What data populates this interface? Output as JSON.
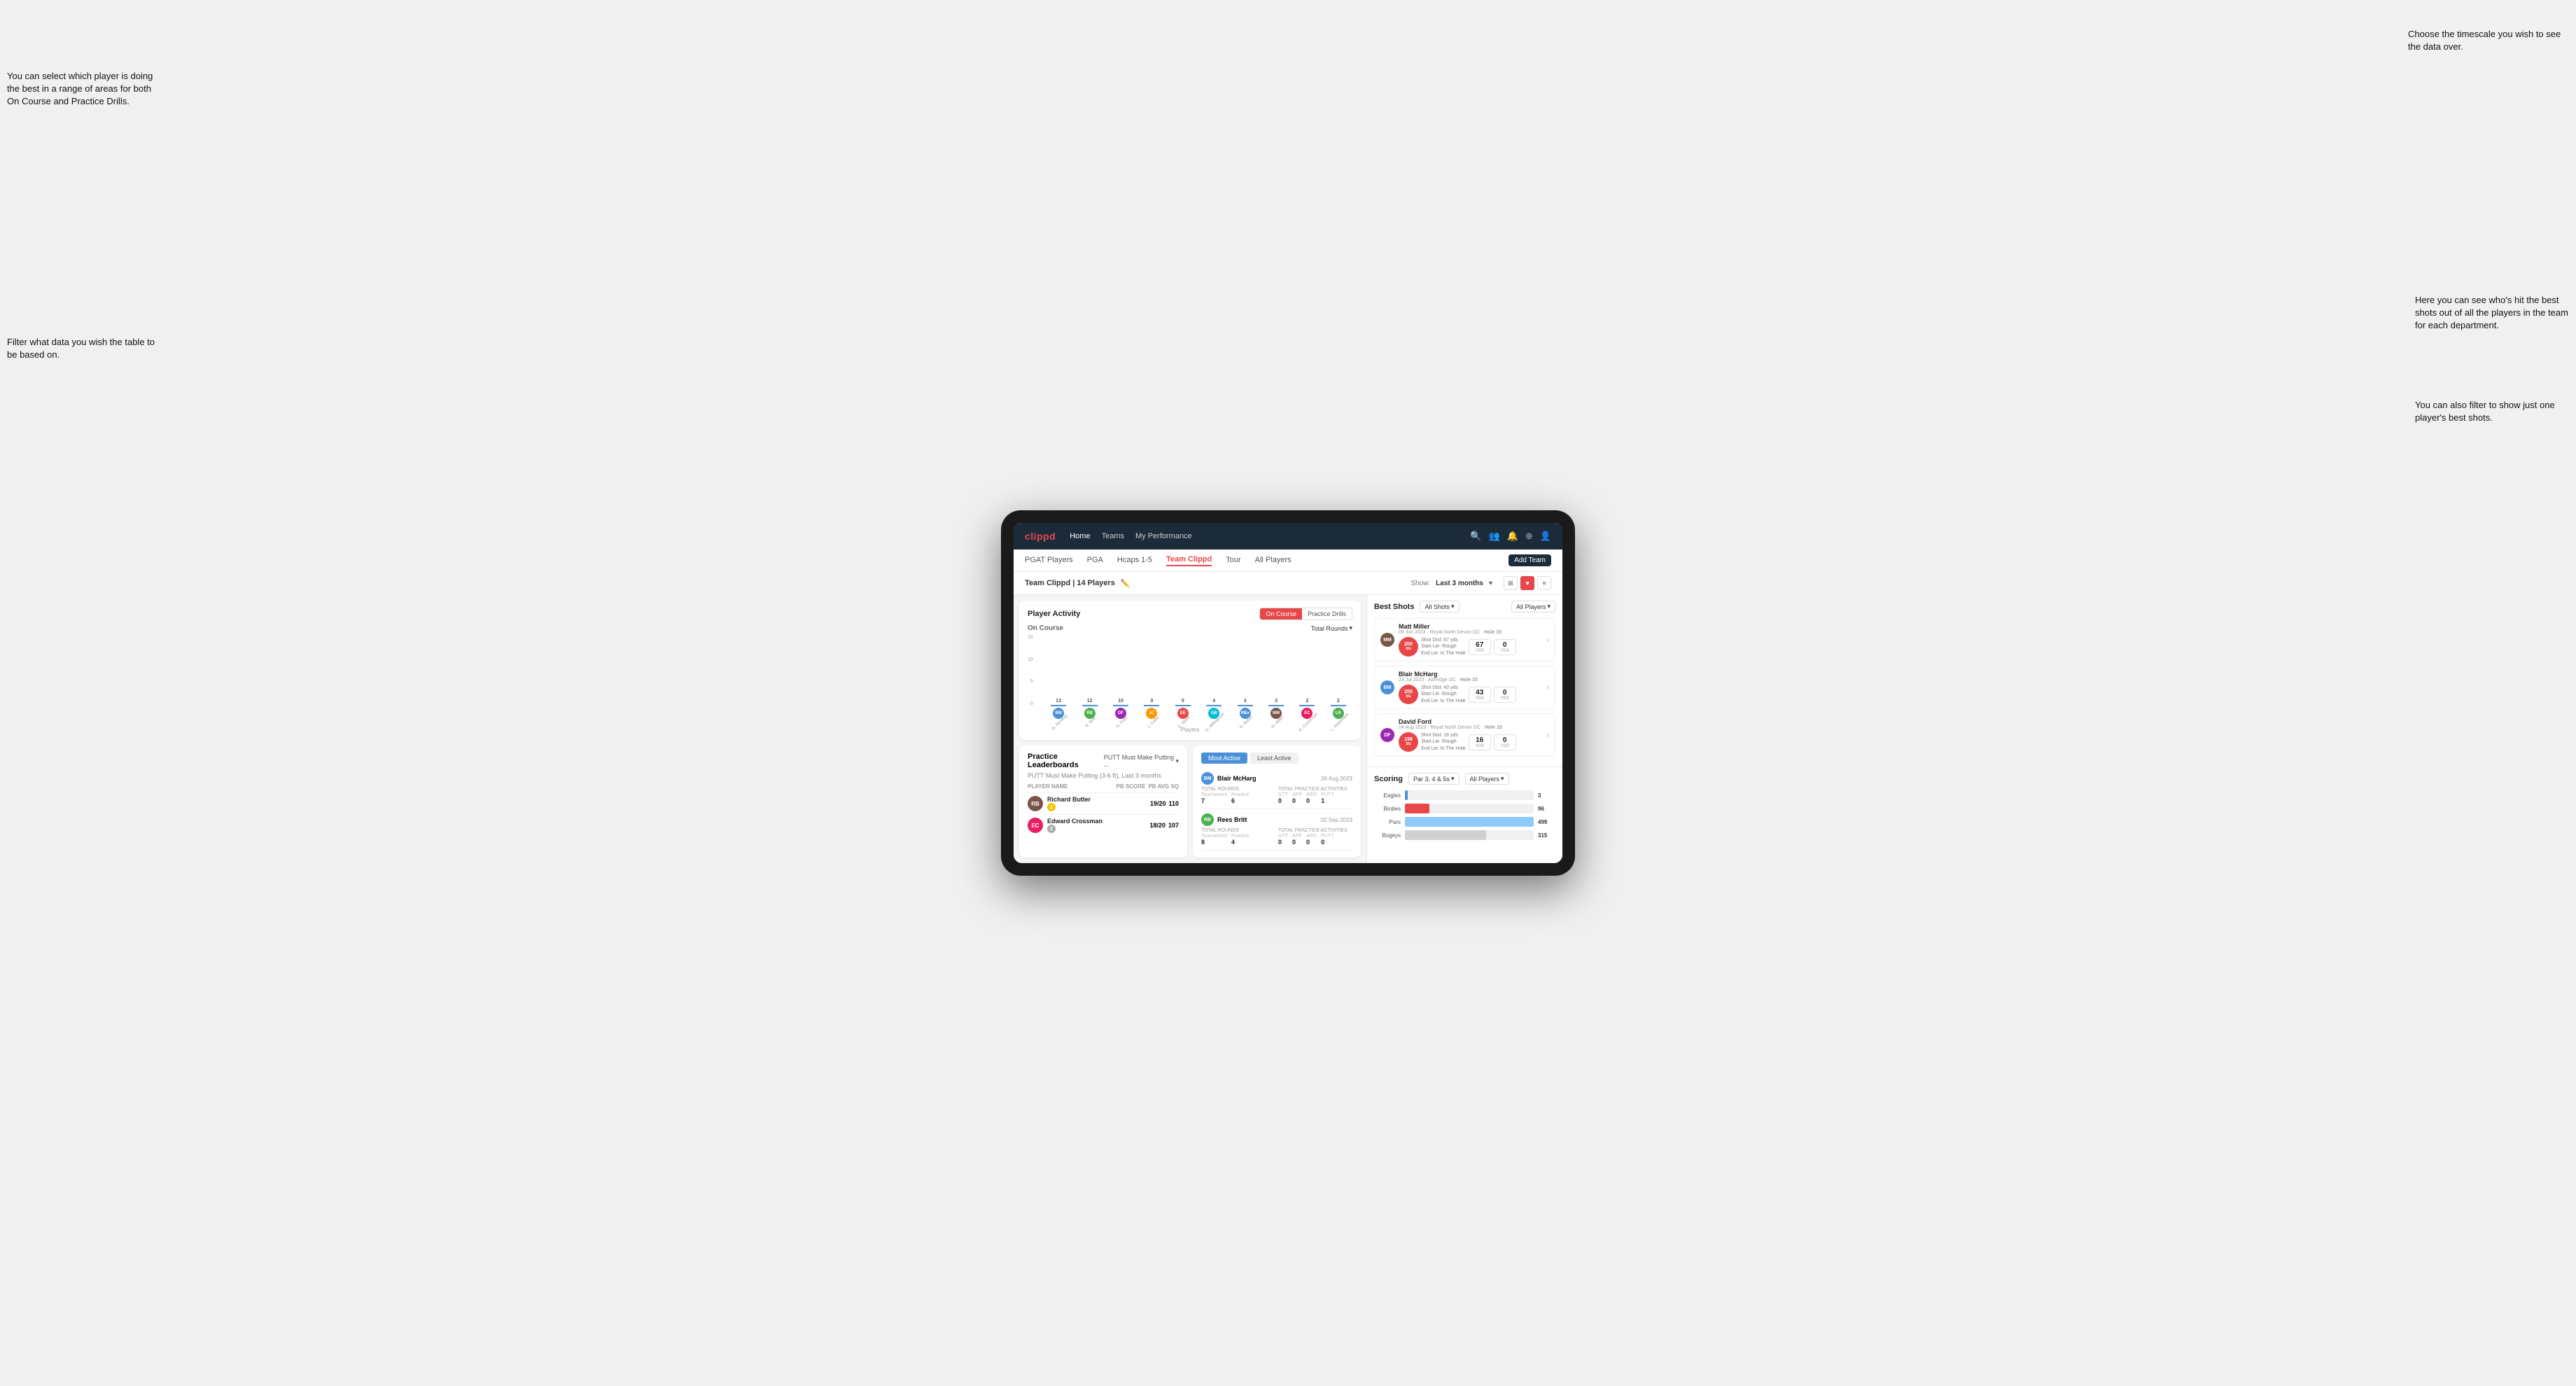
{
  "annotations": {
    "top_right": "Choose the timescale you wish to see the data over.",
    "left_top": "You can select which player is doing the best in a range of areas for both On Course and Practice Drills.",
    "left_bottom": "Filter what data you wish the table to be based on.",
    "right_mid": "Here you can see who's hit the best shots out of all the players in the team for each department.",
    "right_bottom": "You can also filter to show just one player's best shots."
  },
  "navbar": {
    "logo": "clippd",
    "links": [
      "Home",
      "Teams",
      "My Performance"
    ],
    "icons": [
      "search",
      "people",
      "bell",
      "plus-circle",
      "user-circle"
    ]
  },
  "sub_nav": {
    "tabs": [
      "PGAT Players",
      "PGA",
      "Hcaps 1-5",
      "Team Clippd",
      "Tour",
      "All Players"
    ],
    "active": "Team Clippd",
    "add_btn": "Add Team"
  },
  "team_header": {
    "team_name": "Team Clippd | 14 Players",
    "show_label": "Show:",
    "show_value": "Last 3 months",
    "view_icons": [
      "grid",
      "heart",
      "list"
    ]
  },
  "player_activity": {
    "title": "Player Activity",
    "toggle_options": [
      "On Course",
      "Practice Drills"
    ],
    "section_title": "On Course",
    "chart_dropdown": "Total Rounds",
    "y_labels": [
      "15",
      "10",
      "5",
      "0"
    ],
    "bars": [
      {
        "name": "B. McHarg",
        "value": 13,
        "height": 87,
        "initials": "BM",
        "color": "av-blue"
      },
      {
        "name": "R. Britt",
        "value": 12,
        "height": 80,
        "initials": "RB",
        "color": "av-green"
      },
      {
        "name": "D. Ford",
        "value": 10,
        "height": 67,
        "initials": "DF",
        "color": "av-purple"
      },
      {
        "name": "J. Coles",
        "value": 9,
        "height": 60,
        "initials": "JC",
        "color": "av-orange"
      },
      {
        "name": "E. Ebert",
        "value": 5,
        "height": 33,
        "initials": "EE",
        "color": "av-red"
      },
      {
        "name": "G. Billingham",
        "value": 4,
        "height": 27,
        "initials": "GB",
        "color": "av-teal"
      },
      {
        "name": "R. Butler",
        "value": 3,
        "height": 20,
        "initials": "RBu",
        "color": "av-blue"
      },
      {
        "name": "M. Miller",
        "value": 3,
        "height": 20,
        "initials": "MM",
        "color": "av-brown"
      },
      {
        "name": "E. Crossman",
        "value": 2,
        "height": 13,
        "initials": "EC",
        "color": "av-pink"
      },
      {
        "name": "L. Robertson",
        "value": 2,
        "height": 13,
        "initials": "LR",
        "color": "av-green"
      }
    ],
    "x_label": "Players",
    "y_axis_label": "Total Rounds"
  },
  "practice_leaderboards": {
    "title": "Practice Leaderboards",
    "dropdown": "PUTT Must Make Putting ...",
    "subtitle": "PUTT Must Make Putting (3-6 ft), Last 3 months",
    "columns": [
      "PLAYER NAME",
      "PB SCORE",
      "PB AVG SQ"
    ],
    "players": [
      {
        "name": "Richard Butler",
        "rank": 1,
        "rank_type": "gold",
        "pb_score": "19/20",
        "pb_avg": "110",
        "initials": "RB",
        "color": "av-brown"
      },
      {
        "name": "Edward Crossman",
        "rank": 2,
        "rank_type": "silver",
        "pb_score": "18/20",
        "pb_avg": "107",
        "initials": "EC",
        "color": "av-pink"
      }
    ]
  },
  "most_active": {
    "tabs": [
      "Most Active",
      "Least Active"
    ],
    "active_tab": "Most Active",
    "players": [
      {
        "name": "Blair McHarg",
        "date": "26 Aug 2023",
        "avatar_color": "av-blue",
        "initials": "BM",
        "total_rounds_label": "Total Rounds",
        "tournament": 7,
        "practice": 6,
        "total_practice_label": "Total Practice Activities",
        "gtt": 0,
        "app": 0,
        "arg": 0,
        "putt": 1
      },
      {
        "name": "Rees Britt",
        "date": "02 Sep 2023",
        "avatar_color": "av-green",
        "initials": "RB",
        "total_rounds_label": "Total Rounds",
        "tournament": 8,
        "practice": 4,
        "total_practice_label": "Total Practice Activities",
        "gtt": 0,
        "app": 0,
        "arg": 0,
        "putt": 0
      }
    ]
  },
  "best_shots": {
    "title": "Best Shots",
    "filter_all_shots": "All Shots",
    "filter_all_players": "All Players",
    "shots": [
      {
        "player_name": "Matt Miller",
        "date_course": "09 Jun 2023 · Royal North Devon GC",
        "hole": "Hole 15",
        "badge_label": "200",
        "badge_sub": "SG",
        "shot_dist": "67 yds",
        "start_lie": "Rough",
        "end_lie": "In The Hole",
        "stat1_val": "67",
        "stat1_label": "yds",
        "stat2_val": "0",
        "stat2_label": "yds",
        "initials": "MM",
        "color": "av-brown",
        "badge_color": "red"
      },
      {
        "player_name": "Blair McHarg",
        "date_course": "23 Jul 2023 · Ashridge GC",
        "hole": "Hole 15",
        "badge_label": "200",
        "badge_sub": "SG",
        "shot_dist": "43 yds",
        "start_lie": "Rough",
        "end_lie": "In The Hole",
        "stat1_val": "43",
        "stat1_label": "yds",
        "stat2_val": "0",
        "stat2_label": "yds",
        "initials": "BM",
        "color": "av-blue",
        "badge_color": "red"
      },
      {
        "player_name": "David Ford",
        "date_course": "24 Aug 2023 · Royal North Devon GC",
        "hole": "Hole 15",
        "badge_label": "198",
        "badge_sub": "SG",
        "shot_dist": "16 yds",
        "start_lie": "Rough",
        "end_lie": "In The Hole",
        "stat1_val": "16",
        "stat1_label": "yds",
        "stat2_val": "0",
        "stat2_label": "yds",
        "initials": "DF",
        "color": "av-purple",
        "badge_color": "red"
      }
    ]
  },
  "scoring": {
    "title": "Scoring",
    "filter_par": "Par 3, 4 & 5s",
    "filter_players": "All Players",
    "rows": [
      {
        "label": "Eagles",
        "value": 3,
        "bar_pct": 2,
        "color": "eagle"
      },
      {
        "label": "Birdies",
        "value": 96,
        "bar_pct": 19,
        "color": "birdie"
      },
      {
        "label": "Pars",
        "value": 499,
        "bar_pct": 100,
        "color": "par"
      },
      {
        "label": "Bogeys",
        "value": 315,
        "bar_pct": 63,
        "color": "bogey"
      }
    ]
  }
}
